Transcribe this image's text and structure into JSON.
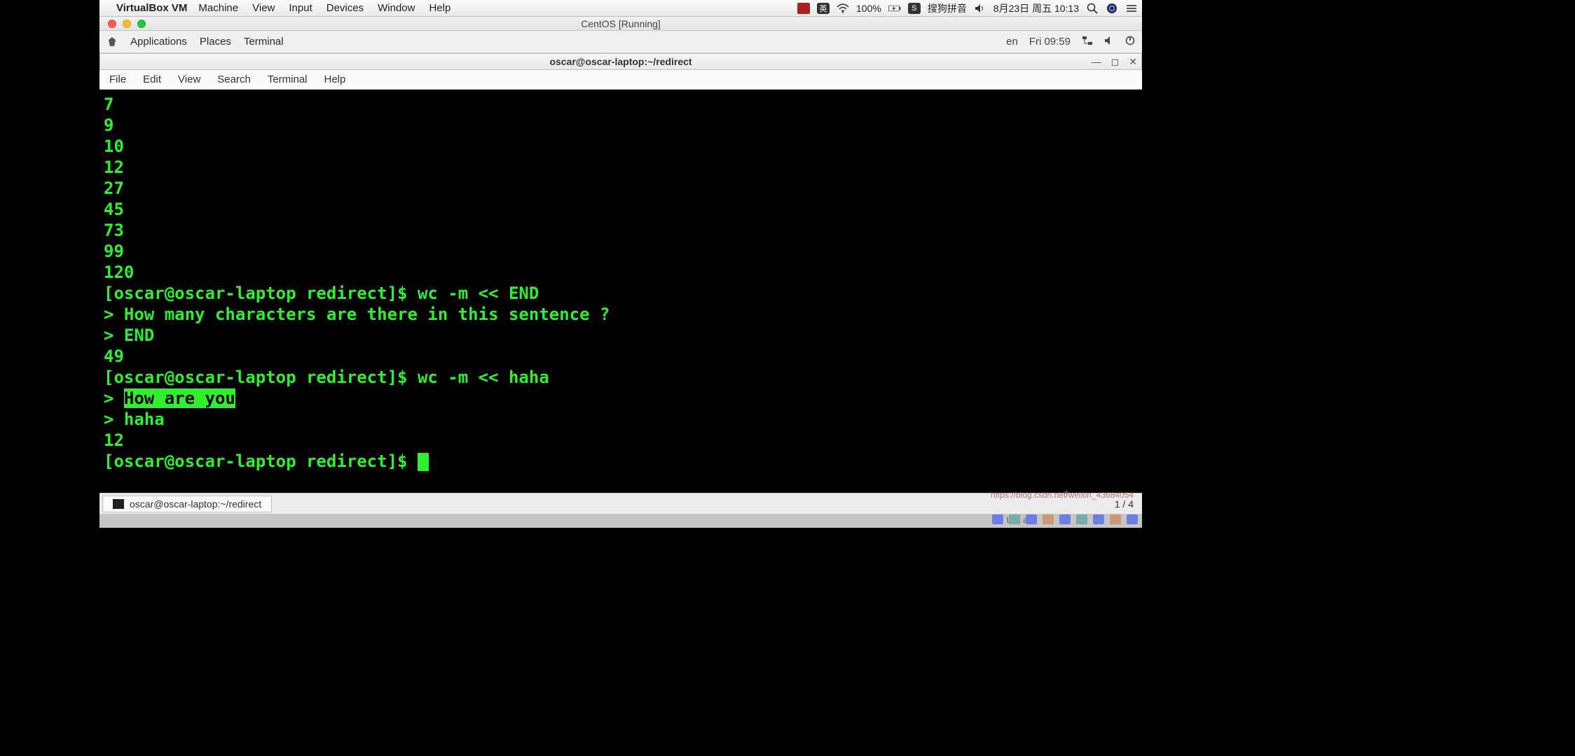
{
  "mac_menubar": {
    "app": "VirtualBox VM",
    "items": [
      "Machine",
      "View",
      "Input",
      "Devices",
      "Window",
      "Help"
    ],
    "battery": "100%",
    "ime": "搜狗拼音",
    "date": "8月23日 周五 10:13"
  },
  "vm_window": {
    "title": "CentOS [Running]"
  },
  "gnome_bar": {
    "items": [
      "Applications",
      "Places",
      "Terminal"
    ],
    "lang": "en",
    "clock": "Fri 09:59"
  },
  "terminal_window": {
    "title": "oscar@oscar-laptop:~/redirect",
    "menus": [
      "File",
      "Edit",
      "View",
      "Search",
      "Terminal",
      "Help"
    ]
  },
  "terminal_output": {
    "nums": [
      "7",
      "9",
      "10",
      "12",
      "27",
      "45",
      "73",
      "99",
      "120"
    ],
    "prompt": "[oscar@oscar-laptop redirect]$ ",
    "cmd1": "wc -m << END",
    "heredoc1_line1": "> How many characters are there in this sentence ?",
    "heredoc1_end": "> END",
    "result1": "49",
    "cmd2": "wc -m << haha",
    "heredoc2_lead": "> ",
    "heredoc2_hl": "How are you",
    "heredoc2_end": "> haha",
    "result2": "12"
  },
  "taskbar": {
    "btn_label": "oscar@oscar-laptop:~/redirect",
    "pager": "1 / 4"
  },
  "host_strip": {
    "left_at": "Left at"
  },
  "watermark": {
    "text": "https://blog.csdn.net/weixin_43684054"
  }
}
